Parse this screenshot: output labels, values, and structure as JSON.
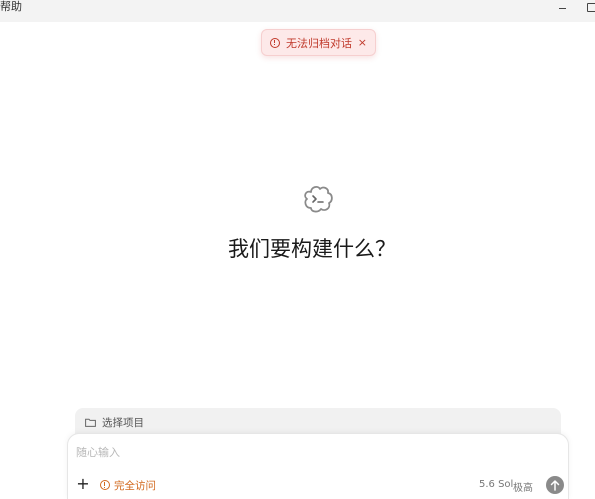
{
  "menubar": {
    "help_label": "帮助"
  },
  "toast": {
    "message": "无法归档对话",
    "close_glyph": "×",
    "color": "#c0392b"
  },
  "hero": {
    "title": "我们要构建什么？"
  },
  "project_selector": {
    "label": "选择项目"
  },
  "composer": {
    "placeholder": "随心输入",
    "value": "",
    "add_glyph": "+",
    "access_label": "完全访问",
    "access_color": "#d2691e",
    "model_label": "5.6 Sol",
    "effort_label": "极高"
  },
  "icons": {
    "window_minimize": "minimize-icon",
    "window_maximize": "maximize-icon",
    "toast": "alert-circle-icon",
    "hero": "terminal-cloud-icon",
    "folder": "folder-icon",
    "access": "alert-circle-icon",
    "send": "arrow-up-icon"
  }
}
